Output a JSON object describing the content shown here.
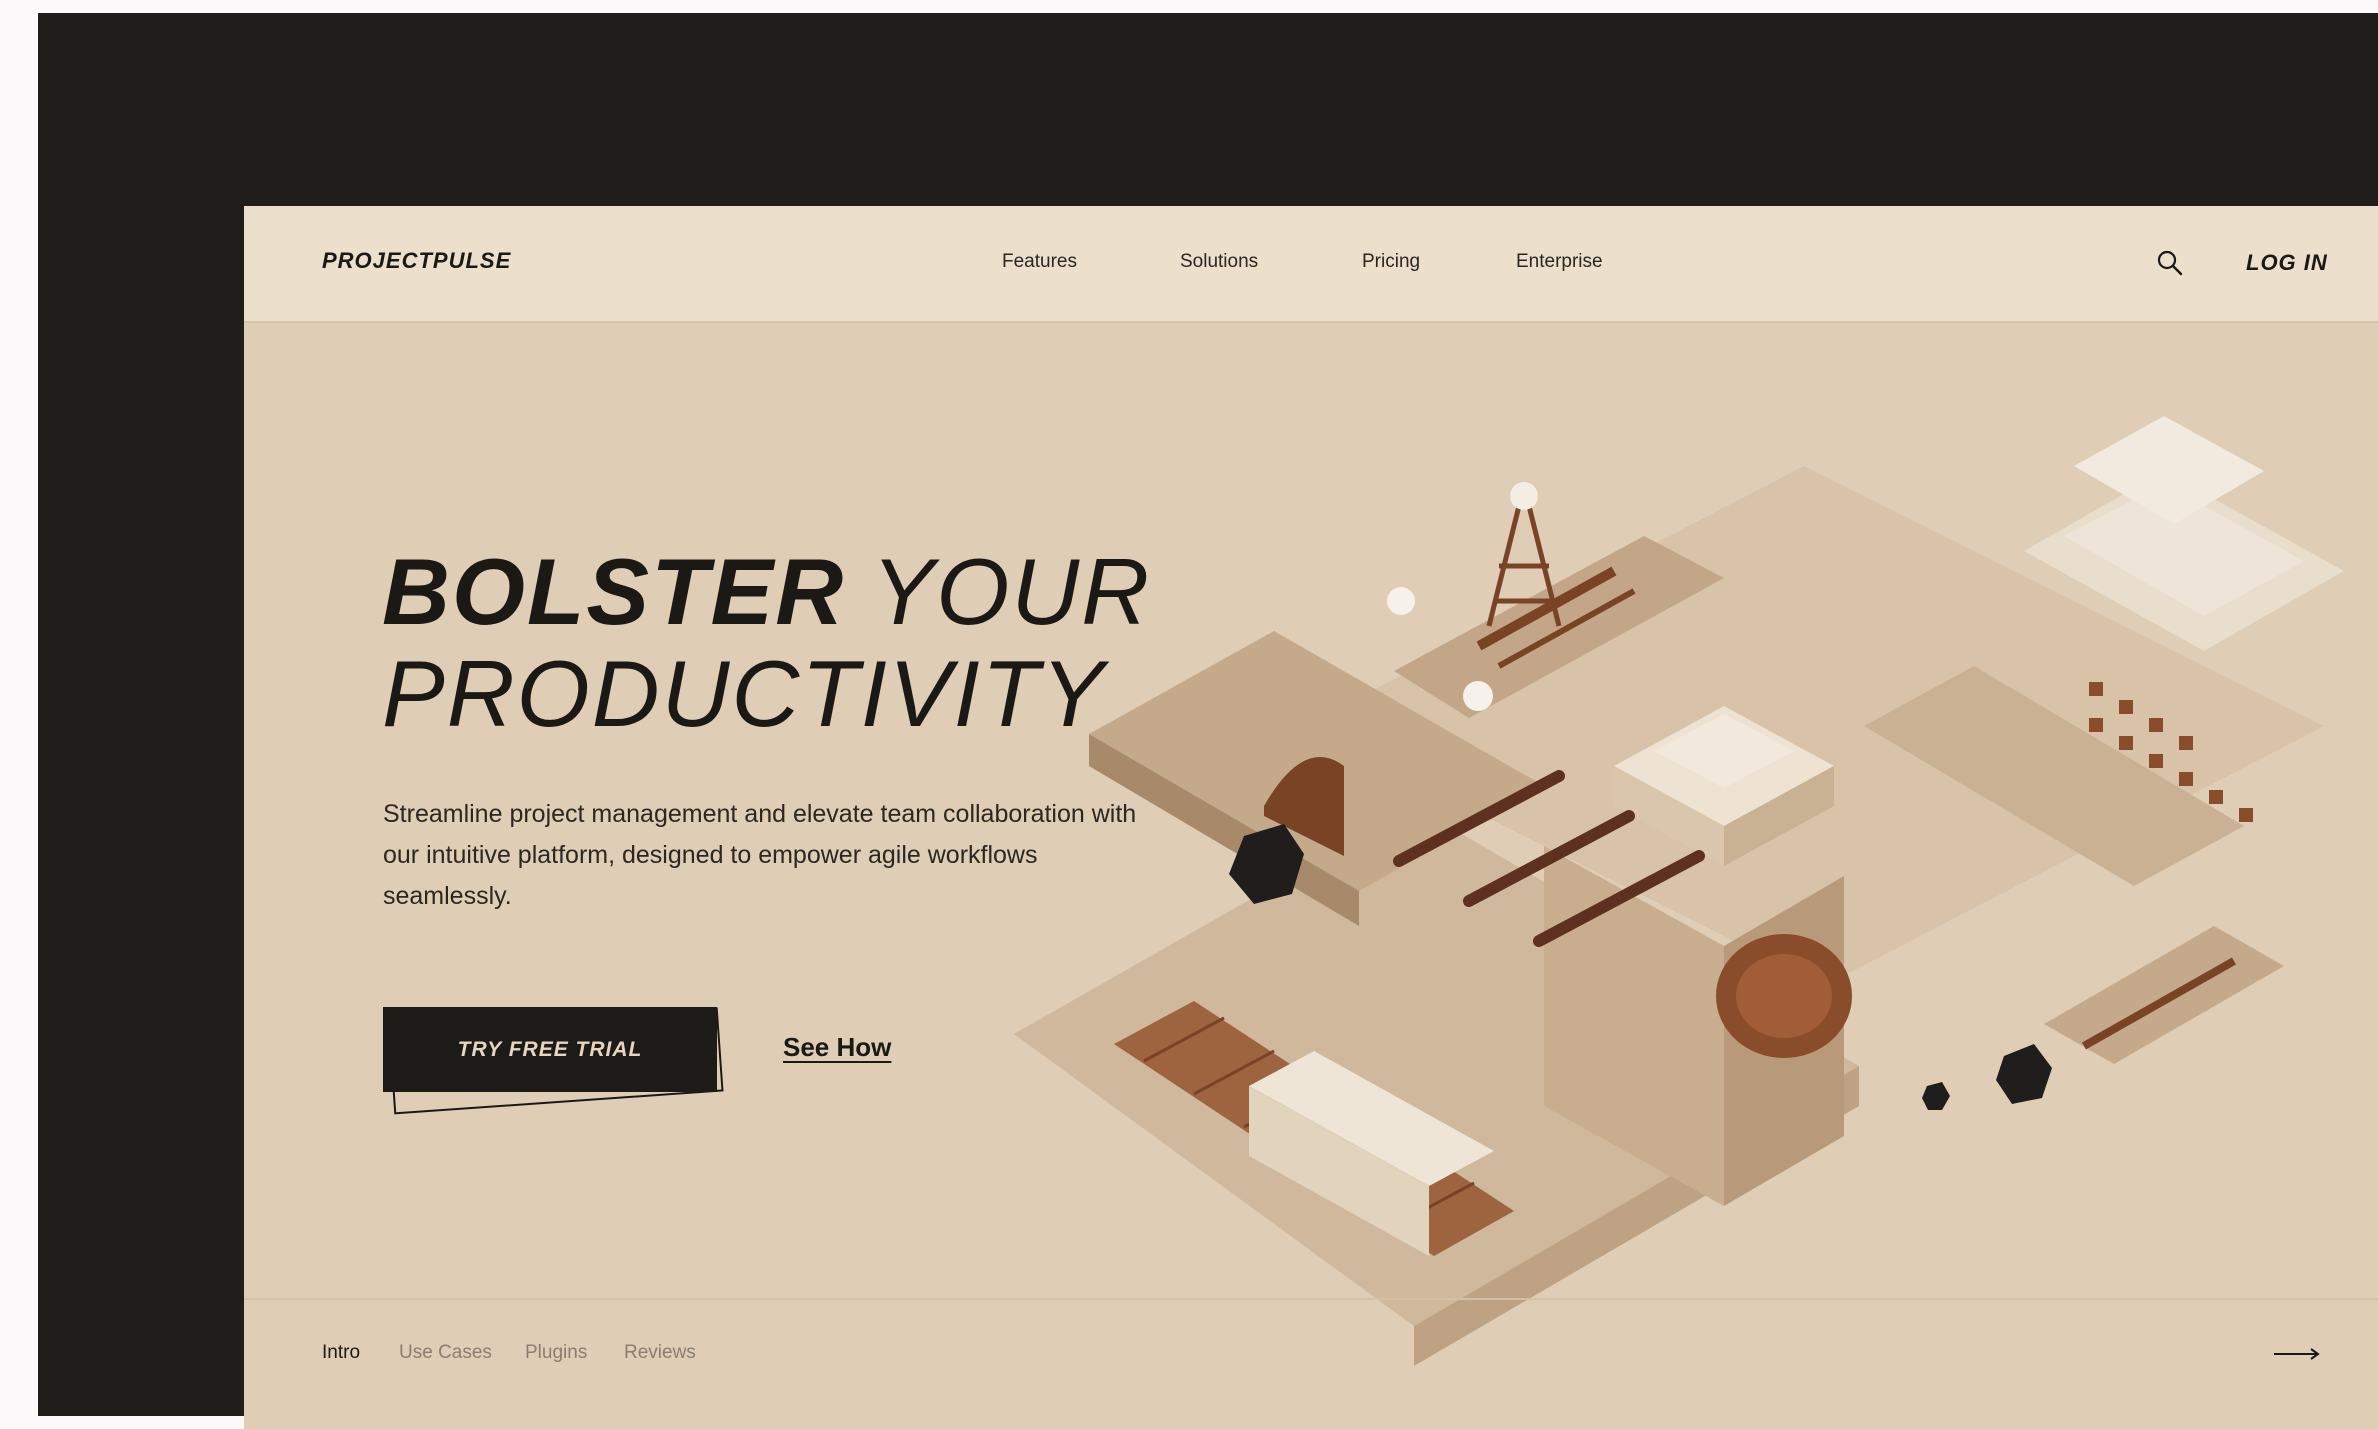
{
  "header": {
    "brand": "PROJECTPULSE",
    "nav": [
      "Features",
      "Solutions",
      "Pricing",
      "Enterprise"
    ],
    "search_icon": "search-icon",
    "login": "LOG IN"
  },
  "hero": {
    "title_bold": "BOLSTER",
    "title_rest_1": "YOUR",
    "title_line_2": "PRODUCTIVITY",
    "description": "Streamline project management and elevate team collaboration with our intuitive platform, designed to empower agile workflows seamlessly.",
    "cta_primary": "TRY FREE TRIAL",
    "cta_secondary": "See How"
  },
  "footer_tabs": {
    "items": [
      "Intro",
      "Use Cases",
      "Plugins",
      "Reviews"
    ],
    "active": "Intro",
    "next_icon": "arrow-right-icon"
  },
  "colors": {
    "frame": "#201e1b",
    "page_bg": "#dfcdb6",
    "header_bg": "#ecdfcc",
    "text_dark": "#1b1916",
    "accent_brown": "#7a4326"
  }
}
